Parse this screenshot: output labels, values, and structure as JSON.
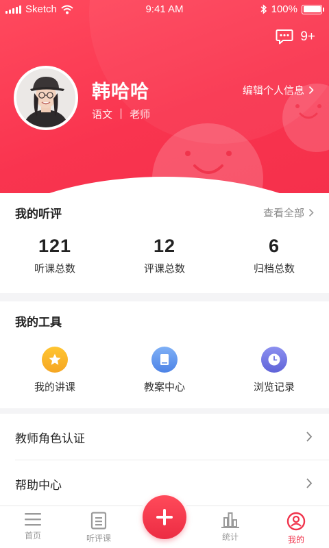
{
  "status_bar": {
    "carrier": "Sketch",
    "time": "9:41 AM",
    "battery": "100%",
    "icons": [
      "signal-icon",
      "wifi-icon",
      "bluetooth-icon",
      "battery-icon"
    ]
  },
  "header": {
    "message_badge": "9+",
    "user_name": "韩哈哈",
    "subject": "语文",
    "separator": "|",
    "role": "老师",
    "edit_label": "编辑个人信息",
    "accent_color": "#f5304b"
  },
  "reviews": {
    "title": "我的听评",
    "more_label": "查看全部",
    "stats": [
      {
        "value": "121",
        "label": "听课总数"
      },
      {
        "value": "12",
        "label": "评课总数"
      },
      {
        "value": "6",
        "label": "归档总数"
      }
    ]
  },
  "tools": {
    "title": "我的工具",
    "items": [
      {
        "label": "我的讲课",
        "icon": "star-icon",
        "color": "#f5a623"
      },
      {
        "label": "教案中心",
        "icon": "book-icon",
        "color": "#5b8fe8"
      },
      {
        "label": "浏览记录",
        "icon": "clock-icon",
        "color": "#6f74e0"
      }
    ]
  },
  "menu": [
    {
      "label": "教师角色认证"
    },
    {
      "label": "帮助中心"
    }
  ],
  "tabbar": {
    "tabs": [
      {
        "label": "首页",
        "icon": "menu-icon"
      },
      {
        "label": "听评课",
        "icon": "document-icon"
      },
      {
        "label": "统计",
        "icon": "bar-chart-icon"
      },
      {
        "label": "我的",
        "icon": "user-icon"
      }
    ],
    "active_tab": "我的",
    "fab_icon": "plus-icon"
  }
}
